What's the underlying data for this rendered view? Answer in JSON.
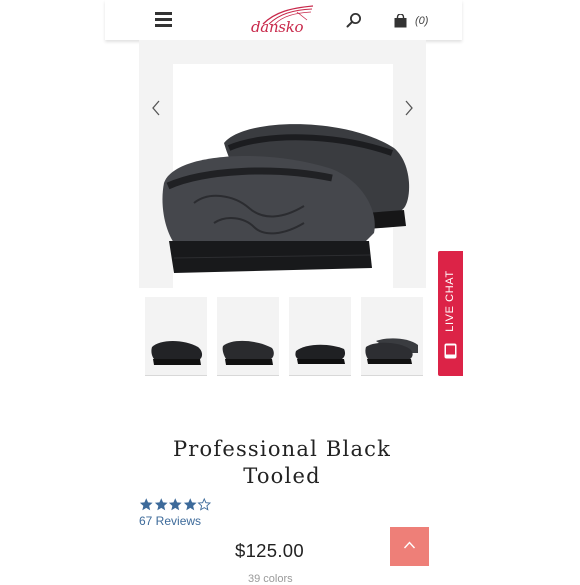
{
  "header": {
    "menu_icon": "hamburger-icon",
    "logo_text": "dansko",
    "search_icon": "search-icon",
    "cart_icon": "shopping-bag-icon",
    "cart_count": "(0)"
  },
  "gallery": {
    "prev_icon": "chevron-left-icon",
    "next_icon": "chevron-right-icon",
    "thumbnail_count": 4
  },
  "live_chat": {
    "label": "LIVE CHAT",
    "icon": "phone-icon",
    "color": "#dc2347"
  },
  "product": {
    "title": "Professional Black Tooled",
    "rating": 4,
    "rating_max": 5,
    "reviews_label": "67 Reviews",
    "price": "$125.00",
    "colors_label": "39 colors"
  },
  "back_to_top": {
    "icon": "chevron-up-icon",
    "color": "#ee7f78"
  },
  "colors": {
    "brand": "#c8284a",
    "star": "#3d6a9a"
  }
}
